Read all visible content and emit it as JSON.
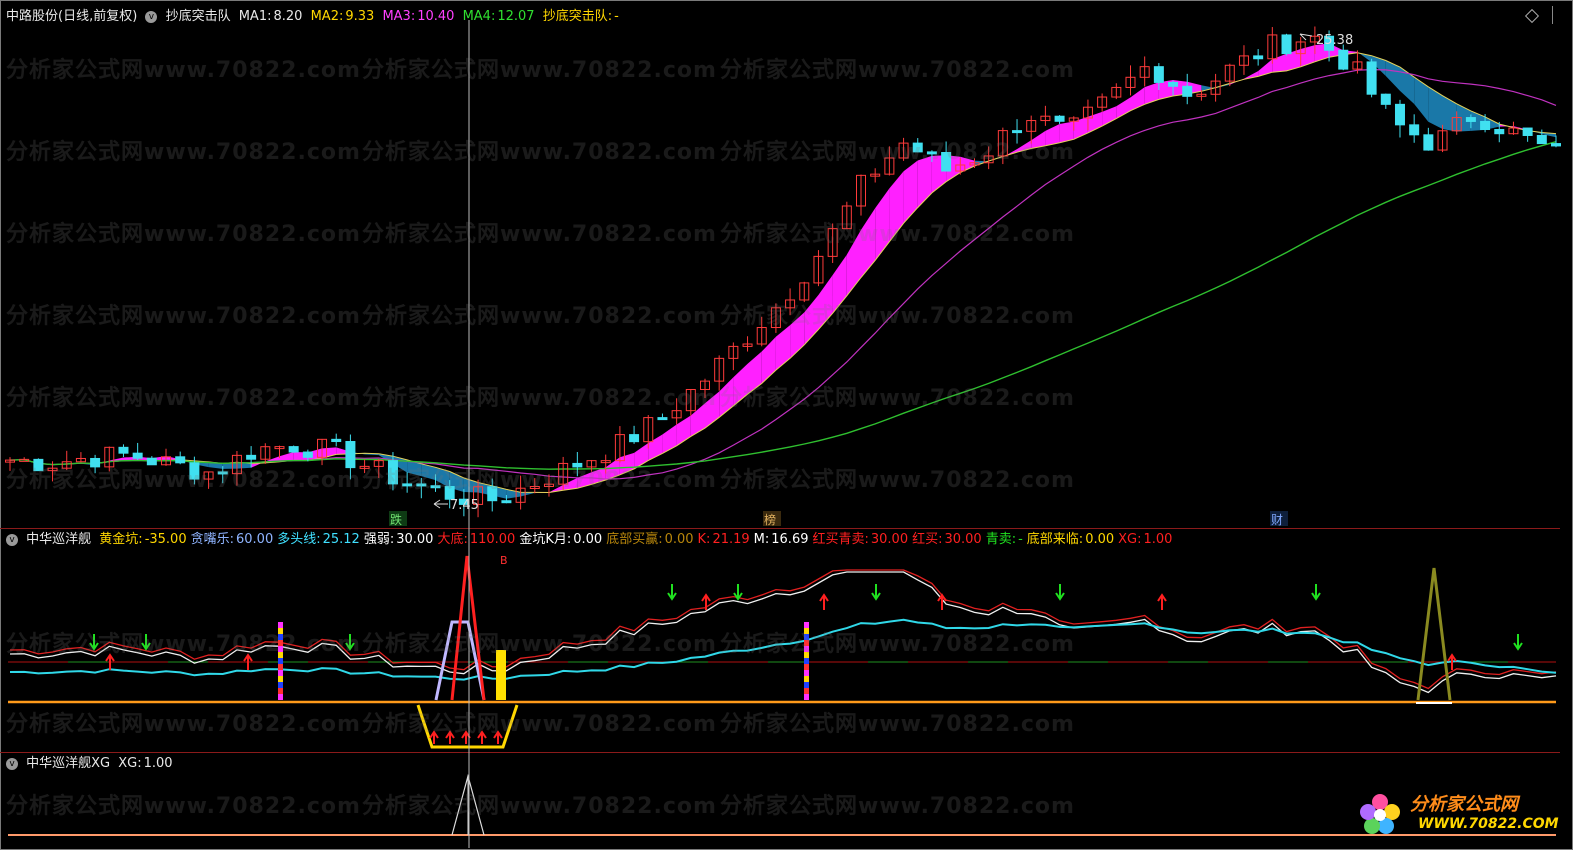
{
  "main_panel": {
    "symbol": "中路股份(日线,前复权)",
    "indicator_name": "抄底突击队",
    "ma1_label": "MA1:",
    "ma1_value": "8.20",
    "ma2_label": "MA2:",
    "ma2_value": "9.33",
    "ma3_label": "MA3:",
    "ma3_value": "10.40",
    "ma4_label": "MA4:",
    "ma4_value": "12.07",
    "signal_label": "抄底突击队:",
    "signal_value": "-",
    "high_marker": "25.38",
    "low_marker": "7.45",
    "tags": [
      "跌",
      "榜",
      "财"
    ]
  },
  "sub_panel": {
    "name": "中华巡洋舰",
    "items": [
      {
        "label": "黄金坑:",
        "value": "-35.00",
        "color": "#ffd700"
      },
      {
        "label": "贪嘴乐:",
        "value": "60.00",
        "color": "#8fb4ff"
      },
      {
        "label": "多头线:",
        "value": "25.12",
        "color": "#40e0ff"
      },
      {
        "label": "强弱:",
        "value": "30.00",
        "color": "#ffffff"
      },
      {
        "label": "大底:",
        "value": "110.00",
        "color": "#ff2020"
      },
      {
        "label": "金坑K月:",
        "value": "0.00",
        "color": "#ffffff"
      },
      {
        "label": "底部买赢:",
        "value": "0.00",
        "color": "#b8860b"
      },
      {
        "label": "K:",
        "value": "21.19",
        "color": "#ff2020"
      },
      {
        "label": "M:",
        "value": "16.69",
        "color": "#ffffff"
      },
      {
        "label": "红买青卖:",
        "value": "30.00",
        "color": "#ff2020"
      },
      {
        "label": "红买:",
        "value": "30.00",
        "color": "#ff2020"
      },
      {
        "label": "青卖:",
        "value": "-",
        "color": "#20e020"
      },
      {
        "label": "底部来临:",
        "value": "0.00",
        "color": "#ffd700"
      },
      {
        "label": "XG:",
        "value": "1.00",
        "color": "#ff2020"
      }
    ],
    "b_marker": "B"
  },
  "xg_panel": {
    "name": "中华巡洋舰XG",
    "label": "XG:",
    "value": "1.00"
  },
  "watermark": "分析家公式网www.70822.com",
  "logo": {
    "name": "分析家公式网",
    "url": "WWW.70822.COM"
  },
  "chart_data": {
    "type": "candlestick",
    "title": "中路股份(日线,前复权)",
    "y_extremes": {
      "high": 25.38,
      "low": 7.45
    },
    "moving_averages": {
      "MA1": 8.2,
      "MA2": 9.33,
      "MA3": 10.4,
      "MA4": 12.07
    },
    "close_trend": [
      9.0,
      8.9,
      9.1,
      9.2,
      8.8,
      8.5,
      9.4,
      9.6,
      9.3,
      8.6,
      8.0,
      7.6,
      7.45,
      8.2,
      8.9,
      9.6,
      10.6,
      12.0,
      13.6,
      15.2,
      17.2,
      19.8,
      21.3,
      20.2,
      20.9,
      22.4,
      21.6,
      22.9,
      24.3,
      23.1,
      24.1,
      25.0,
      25.38,
      24.2,
      22.0,
      21.2,
      22.4,
      21.6,
      20.8
    ],
    "colors": {
      "up": "#ff3b3b",
      "down": "#40e0f0",
      "band_up": "#ff20ff",
      "band_down": "#1a78a8",
      "ma_yellow": "#e6d35a",
      "ma_purple": "#c032c0",
      "ma_green": "#2fbf2f"
    }
  }
}
